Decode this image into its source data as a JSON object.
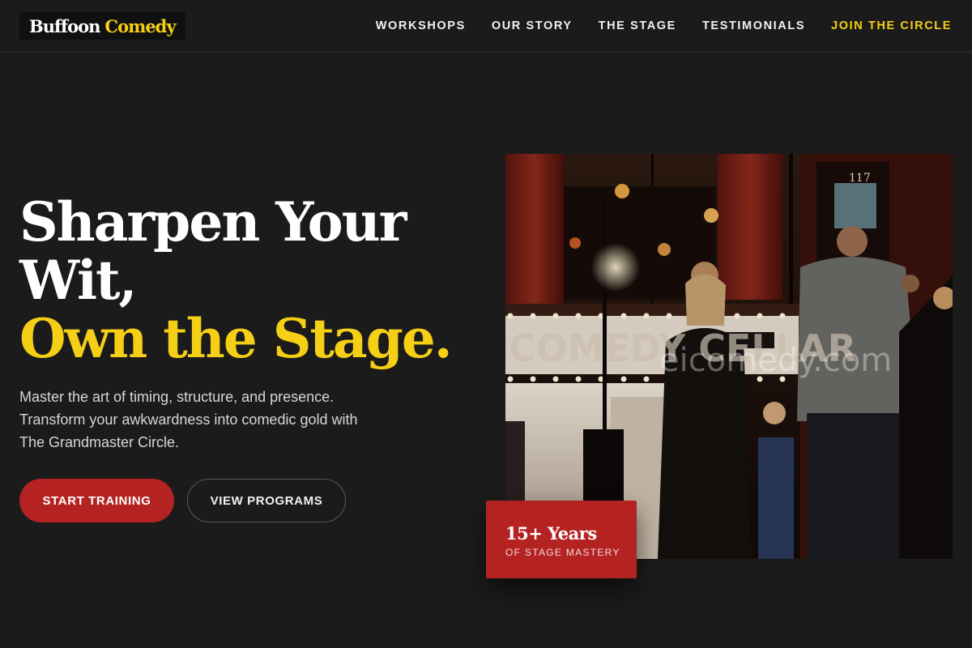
{
  "header": {
    "logo": {
      "word1": "Buffoon",
      "word2": "Comedy"
    },
    "nav": [
      {
        "label": "WORKSHOPS"
      },
      {
        "label": "OUR STORY"
      },
      {
        "label": "THE STAGE"
      },
      {
        "label": "TESTIMONIALS"
      },
      {
        "label": "JOIN THE CIRCLE"
      }
    ]
  },
  "hero": {
    "headline_line1": "Sharpen Your",
    "headline_line2": "Wit,",
    "headline_accent": "Own the Stage.",
    "subtext": "Master the art of timing, structure, and presence. Transform your awkwardness into comedic gold with The Grandmaster Circle.",
    "primary_cta": "START TRAINING",
    "secondary_cta": "VIEW PROGRAMS"
  },
  "image": {
    "sign_text": "COMEDY CELLAR",
    "watermark": "eicomedy.com",
    "door_number": "117"
  },
  "badge": {
    "value": "15+ Years",
    "caption": "OF STAGE MASTERY"
  },
  "colors": {
    "background": "#1b1b1b",
    "accent_yellow": "#f5cf16",
    "brand_red": "#b52222"
  }
}
